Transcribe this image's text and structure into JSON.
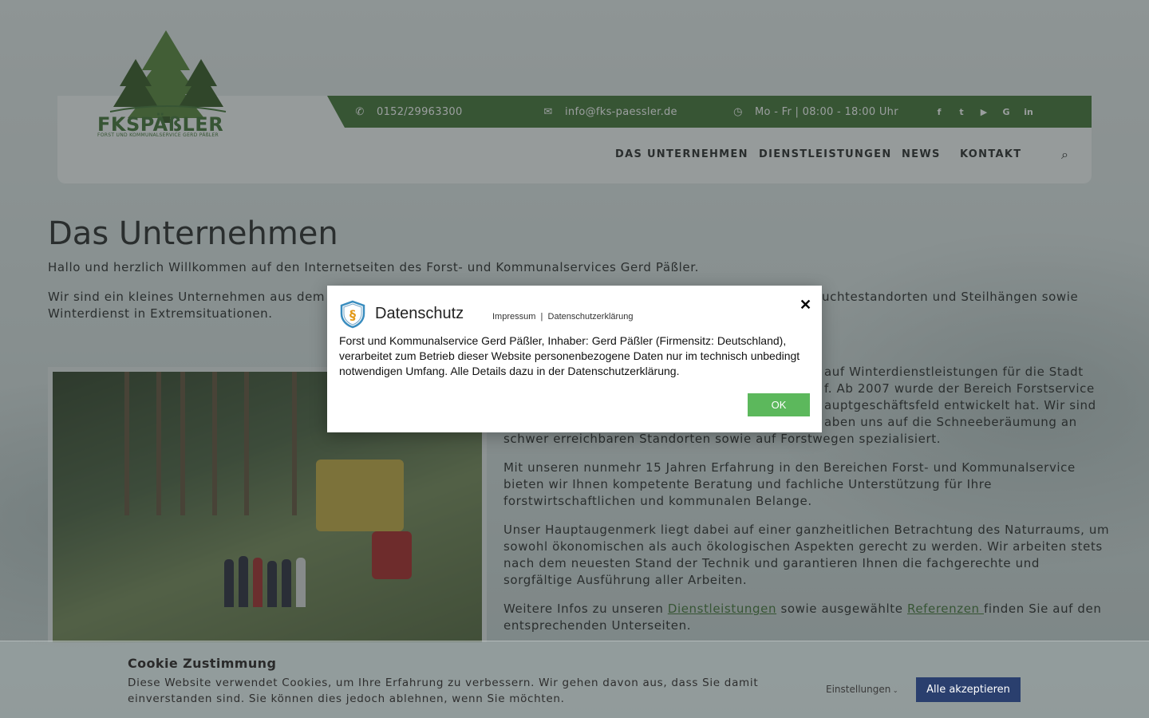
{
  "brand": {
    "name": "FKSPÄßLER",
    "subtitle": "FORST UND KOMMUNALSERVICE GERD PÄßLER",
    "green": "#4b7a3f"
  },
  "topbar": {
    "phone": "0152/29963300",
    "email": "info@fks-paessler.de",
    "hours": "Mo - Fr | 08:00 - 18:00 Uhr",
    "social": [
      "facebook-icon",
      "twitter-icon",
      "youtube-icon",
      "google-icon",
      "linkedin-icon"
    ]
  },
  "nav": {
    "items": [
      "DAS UNTERNEHMEN",
      "DIENSTLEISTUNGEN",
      "NEWS",
      "KONTAKT"
    ]
  },
  "main": {
    "title": "Das Unternehmen",
    "intro": "Hallo und herzlich Willkommen auf den Internetseiten des Forst- und Kommunalservices Gerd Päßler.",
    "p1a": "Wir sind ein kleines Unternehmen aus dem E",
    "p1b": "uchtestandorten und Steilhängen sowie",
    "p1c": "Winterdienst in Extremsituationen.",
    "p2l1": "auf Winterdienstleistungen für die Stadt",
    "p2l2": "f. Ab 2007 wurde der Bereich Forstservice",
    "p2l3": "auptgeschäftsfeld entwickelt hat. Wir sind",
    "p2l4": "aben uns auf die Schneeberäumung an",
    "p2l5": "schwer erreichbaren Standorten sowie auf Forstwegen spezialisiert.",
    "p3": "Mit unseren nunmehr 15 Jahren Erfahrung in den Bereichen Forst- und Kommunalservice bieten wir Ihnen kompetente Beratung und fachliche Unterstützung für Ihre forstwirtschaftlichen und kommunalen Belange.",
    "p4": "Unser Hauptaugenmerk liegt dabei auf einer ganzheitlichen Betrachtung des Naturraums, um sowohl ökonomischen als auch ökologischen Aspekten gerecht zu werden. Wir arbeiten stets nach dem neuesten Stand der Technik und garantieren Ihnen die fachgerechte und sorgfältige Ausführung aller Arbeiten.",
    "p5_before": "Weitere Infos zu unseren ",
    "p5_link1": "Dienstleistungen",
    "p5_middle": " sowie ausgewählte ",
    "p5_link2": "Referenzen ",
    "p5_after": "finden Sie auf den entsprechenden Unterseiten."
  },
  "modal": {
    "title": "Datenschutz",
    "link_impressum": "Impressum",
    "separator": "|",
    "link_privacy": "Datenschutzerklärung",
    "close": "✕",
    "body": "Forst und Kommunalservice Gerd Päßler, Inhaber: Gerd Päßler (Firmensitz: Deutschland), verarbeitet zum Betrieb dieser Website personenbezogene Daten nur im technisch unbedingt notwendigen Umfang. Alle Details dazu in der Datenschutzerklärung.",
    "ok": "OK"
  },
  "cookie": {
    "title": "Cookie Zustimmung",
    "text": "Diese Website verwendet Cookies, um Ihre Erfahrung zu verbessern. Wir gehen davon aus, dass Sie damit einverstanden sind. Sie können dies jedoch ablehnen, wenn Sie möchten.",
    "settings": "Einstellungen",
    "accept": "Alle akzeptieren"
  }
}
